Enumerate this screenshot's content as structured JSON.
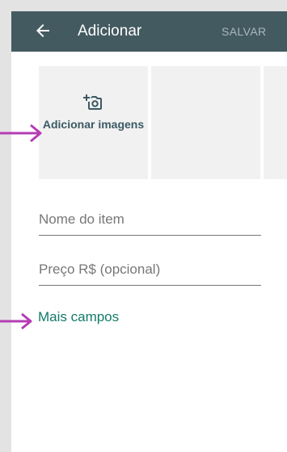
{
  "appbar": {
    "title": "Adicionar",
    "action_label": "SALVAR",
    "back_icon": "arrow-back-icon"
  },
  "photos": {
    "add_icon": "add-camera-icon",
    "add_label": "Adicionar imagens"
  },
  "fields": {
    "name_placeholder": "Nome do item",
    "price_placeholder": "Preço R$ (opcional)"
  },
  "more_fields_label": "Mais campos",
  "colors": {
    "appbar": "#435a60",
    "accent_link": "#137a6a",
    "annotation_arrow": "#b43db4"
  }
}
